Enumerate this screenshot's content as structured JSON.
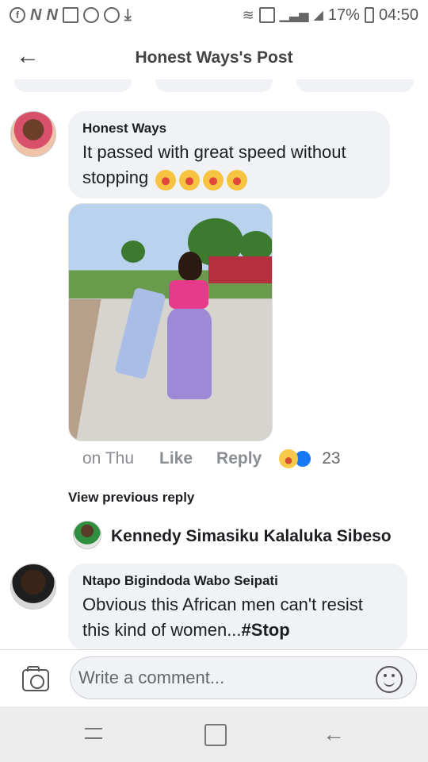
{
  "status_bar": {
    "battery": "17%",
    "time": "04:50",
    "icons": [
      "facebook-icon",
      "n-icon",
      "n-icon",
      "image-icon",
      "circle-icon",
      "circle-icon",
      "download-icon",
      "wifi-icon",
      "sim-icon",
      "signal-icon",
      "signal-icon",
      "battery-icon"
    ]
  },
  "header": {
    "title": "Honest Ways's Post",
    "back_icon": "back-arrow-icon"
  },
  "comment": {
    "author": "Honest Ways",
    "text": "It passed with great speed without stopping",
    "emoji_count": 4,
    "emoji": "rolling-on-floor-laughing",
    "time": "on Thu",
    "like_label": "Like",
    "reply_label": "Reply",
    "reaction_icons": [
      "laugh-reaction-icon",
      "like-reaction-icon"
    ],
    "reaction_count": "23"
  },
  "view_previous_reply": "View previous reply",
  "reply_preview_name": "Kennedy Simasiku Kalaluka Sibeso",
  "reply": {
    "author": "Ntapo Bigindoda Wabo Seipati",
    "text": "Obvious this African men can't resist this kind of women...",
    "hashtag": "#Stop"
  },
  "composer": {
    "placeholder": "Write a comment...",
    "camera_icon": "camera-icon",
    "emoji_icon": "smile-icon"
  },
  "nav": {
    "icons": [
      "recent-apps-icon",
      "home-icon",
      "back-icon"
    ],
    "back_glyph": "←"
  }
}
